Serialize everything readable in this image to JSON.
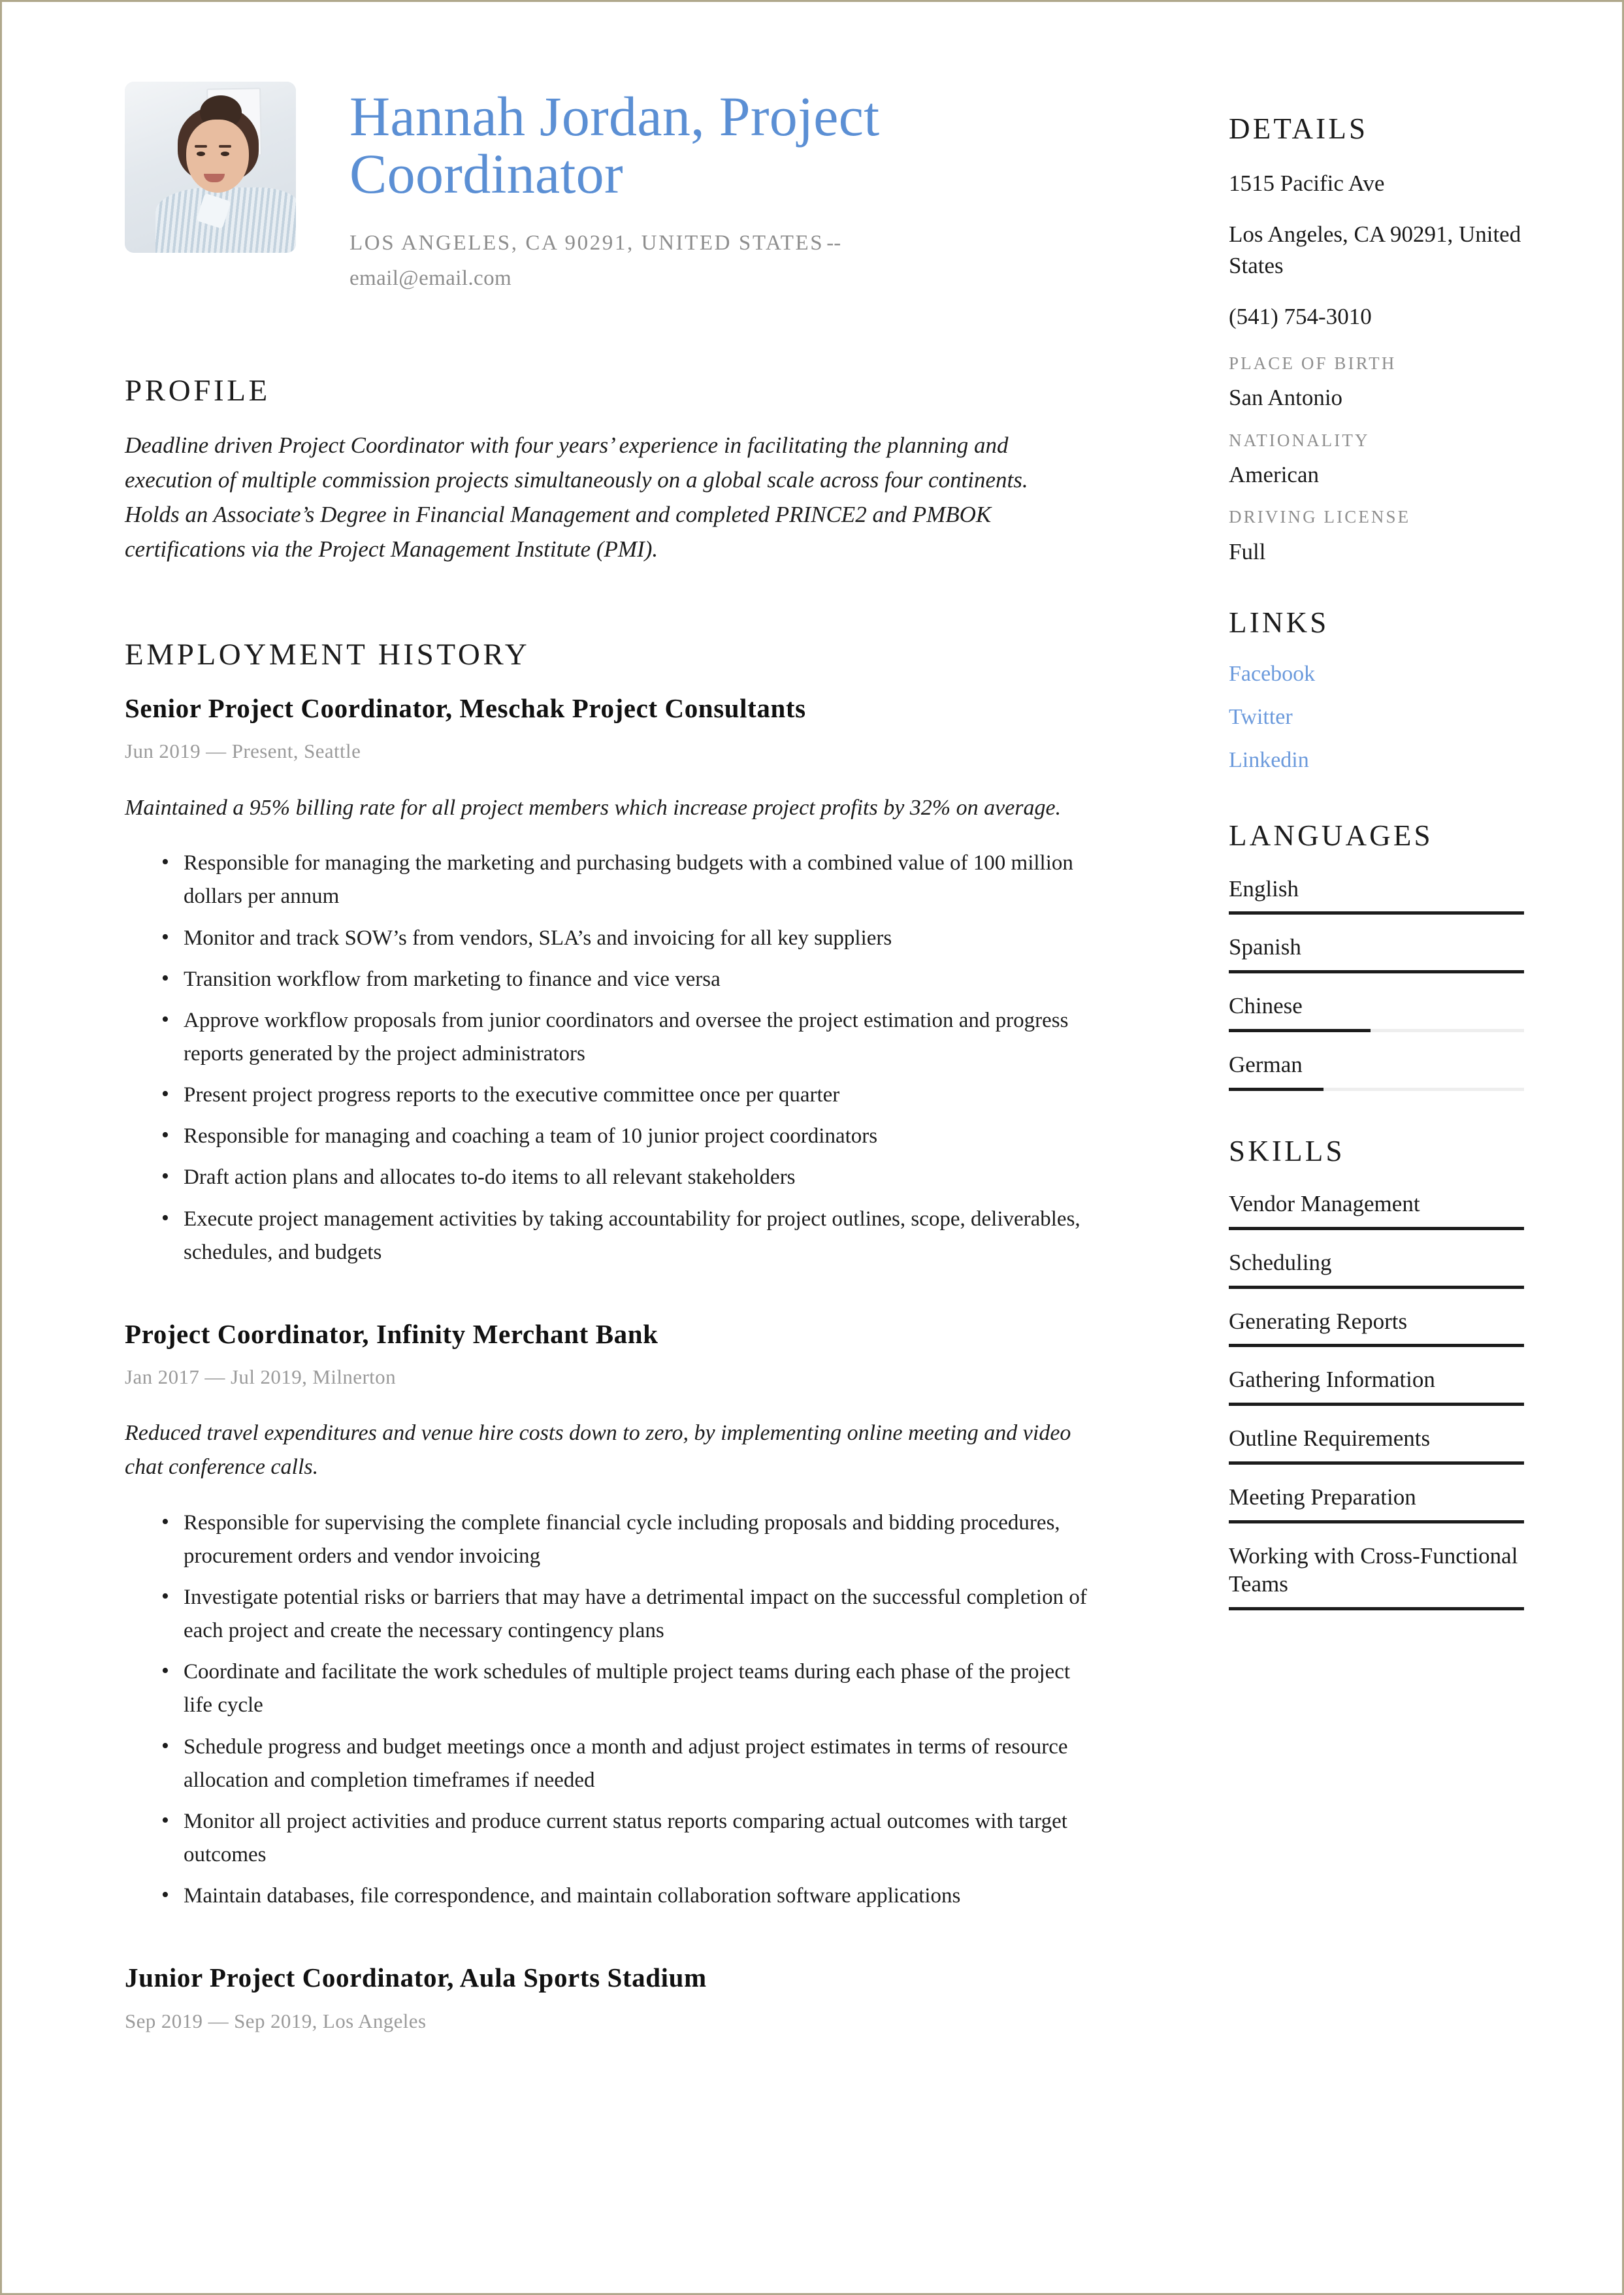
{
  "theme": {
    "accent_blue": "#5b8fd4",
    "link_blue": "#6b9adc",
    "muted_gray": "#8e8e8e",
    "text_dark": "#1b1b1b",
    "border_tan": "#b0a88c"
  },
  "header": {
    "name_title": "Hannah Jordan, Project Coordinator",
    "location_line": "LOS ANGELES, CA 90291, UNITED STATES",
    "separator": "--",
    "email": "email@email.com"
  },
  "profile": {
    "heading": "PROFILE",
    "body": "Deadline driven Project Coordinator with four years’ experience in facilitating the planning and execution of multiple commission projects simultaneously on a global scale across four continents. Holds an Associate’s Degree in Financial Management and completed PRINCE2 and PMBOK certifications via the Project Management Institute (PMI)."
  },
  "employment": {
    "heading": "EMPLOYMENT HISTORY",
    "jobs": [
      {
        "title": "Senior Project Coordinator, Meschak Project Consultants",
        "meta": "Jun 2019 — Present, Seattle",
        "summary": "Maintained a 95% billing rate for all project members which increase project profits by 32% on average.",
        "bullets": [
          "Responsible for managing the marketing and purchasing budgets with a combined value of 100 million dollars per annum",
          "Monitor and track SOW’s from vendors, SLA’s and invoicing for all key suppliers",
          "Transition workflow from marketing to finance and vice versa",
          "Approve workflow proposals from junior coordinators and oversee the project estimation and progress reports generated by the project administrators",
          "Present project progress reports to the executive committee once per quarter",
          "Responsible for managing and coaching a team of 10 junior project coordinators",
          "Draft action plans and allocates to-do items to all relevant stakeholders",
          "Execute project management activities by taking accountability for project outlines, scope, deliverables, schedules, and budgets"
        ]
      },
      {
        "title": "Project Coordinator, Infinity Merchant Bank",
        "meta": "Jan 2017 — Jul 2019, Milnerton",
        "summary": "Reduced travel expenditures and venue hire costs down to zero, by implementing online meeting and video chat conference calls.",
        "bullets": [
          "Responsible for supervising the complete financial cycle including proposals and bidding procedures, procurement orders and vendor invoicing",
          "Investigate potential risks or barriers that may have a detrimental impact on the successful completion of each project and create the necessary contingency plans",
          "Coordinate and facilitate the work schedules of multiple project teams during each phase of the project life cycle",
          "Schedule progress and budget meetings once a month and adjust project estimates in terms of resource allocation and completion timeframes if needed",
          "Monitor all project activities and produce current status reports comparing actual outcomes with target outcomes",
          "Maintain databases, file correspondence, and maintain collaboration software applications"
        ]
      },
      {
        "title": "Junior Project Coordinator, Aula Sports Stadium",
        "meta": "Sep 2019 — Sep 2019, Los Angeles",
        "summary": "",
        "bullets": []
      }
    ]
  },
  "sidebar": {
    "details": {
      "heading": "DETAILS",
      "address_street": "1515 Pacific Ave",
      "address_city": "Los Angeles, CA 90291, United States",
      "phone": "(541) 754-3010",
      "fields": [
        {
          "label": "PLACE OF BIRTH",
          "value": "San Antonio"
        },
        {
          "label": "NATIONALITY",
          "value": "American"
        },
        {
          "label": "DRIVING LICENSE",
          "value": "Full"
        }
      ]
    },
    "links": {
      "heading": "LINKS",
      "items": [
        {
          "label": "Facebook"
        },
        {
          "label": "Twitter"
        },
        {
          "label": "Linkedin"
        }
      ]
    },
    "languages": {
      "heading": "LANGUAGES",
      "items": [
        {
          "label": "English",
          "level": 100
        },
        {
          "label": "Spanish",
          "level": 100
        },
        {
          "label": "Chinese",
          "level": 48
        },
        {
          "label": "German",
          "level": 32
        }
      ]
    },
    "skills": {
      "heading": "SKILLS",
      "items": [
        {
          "label": "Vendor Management",
          "level": 100
        },
        {
          "label": "Scheduling",
          "level": 100
        },
        {
          "label": "Generating Reports",
          "level": 100
        },
        {
          "label": "Gathering Information",
          "level": 100
        },
        {
          "label": "Outline Requirements",
          "level": 100
        },
        {
          "label": "Meeting Preparation",
          "level": 100
        },
        {
          "label": "Working with Cross-Functional Teams",
          "level": 100
        }
      ]
    }
  }
}
